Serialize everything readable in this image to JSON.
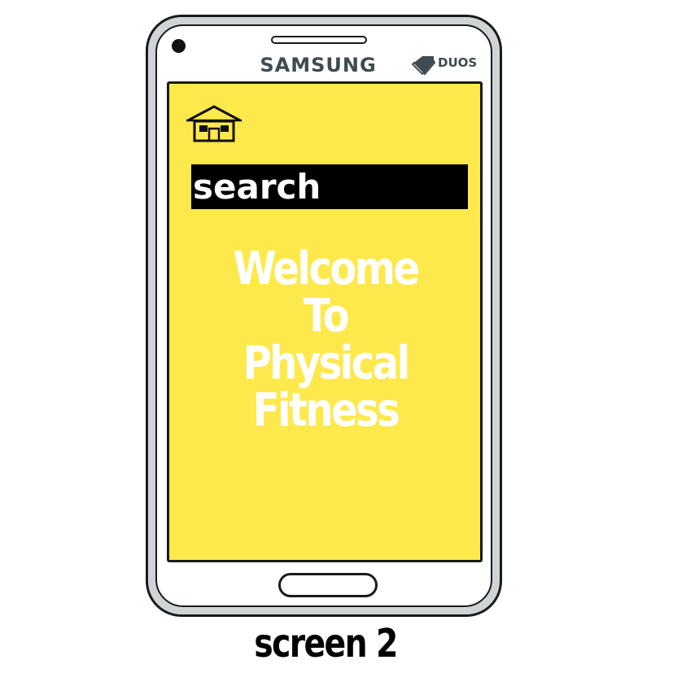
{
  "device": {
    "brand": "SAMSUNG",
    "dual_sim_label": "DUOS"
  },
  "screen": {
    "background_color": "#fde94c",
    "home_icon": "home-icon",
    "search": {
      "label": "search"
    },
    "welcome_lines": [
      "Welcome",
      "To",
      "Physical",
      "Fitness"
    ]
  },
  "caption": "screen 2"
}
